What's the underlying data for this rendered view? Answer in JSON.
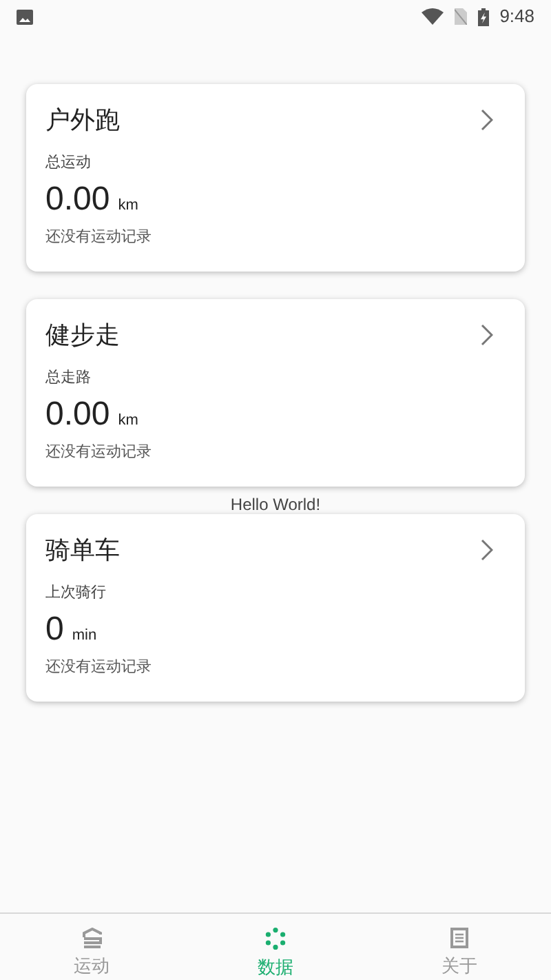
{
  "status_bar": {
    "time": "9:48"
  },
  "cards": [
    {
      "title": "户外跑",
      "label": "总运动",
      "value": "0.00",
      "unit": "km",
      "note": "还没有运动记录"
    },
    {
      "title": "健步走",
      "label": "总走路",
      "value": "0.00",
      "unit": "km",
      "note": "还没有运动记录"
    },
    {
      "title": "骑单车",
      "label": "上次骑行",
      "value": "0",
      "unit": "min",
      "note": "还没有运动记录"
    }
  ],
  "overlay_text": "Hello World!",
  "bottom_nav": [
    {
      "label": "运动",
      "kind": "sport",
      "selected": false
    },
    {
      "label": "数据",
      "kind": "data",
      "selected": true
    },
    {
      "label": "关于",
      "kind": "about",
      "selected": false
    }
  ]
}
